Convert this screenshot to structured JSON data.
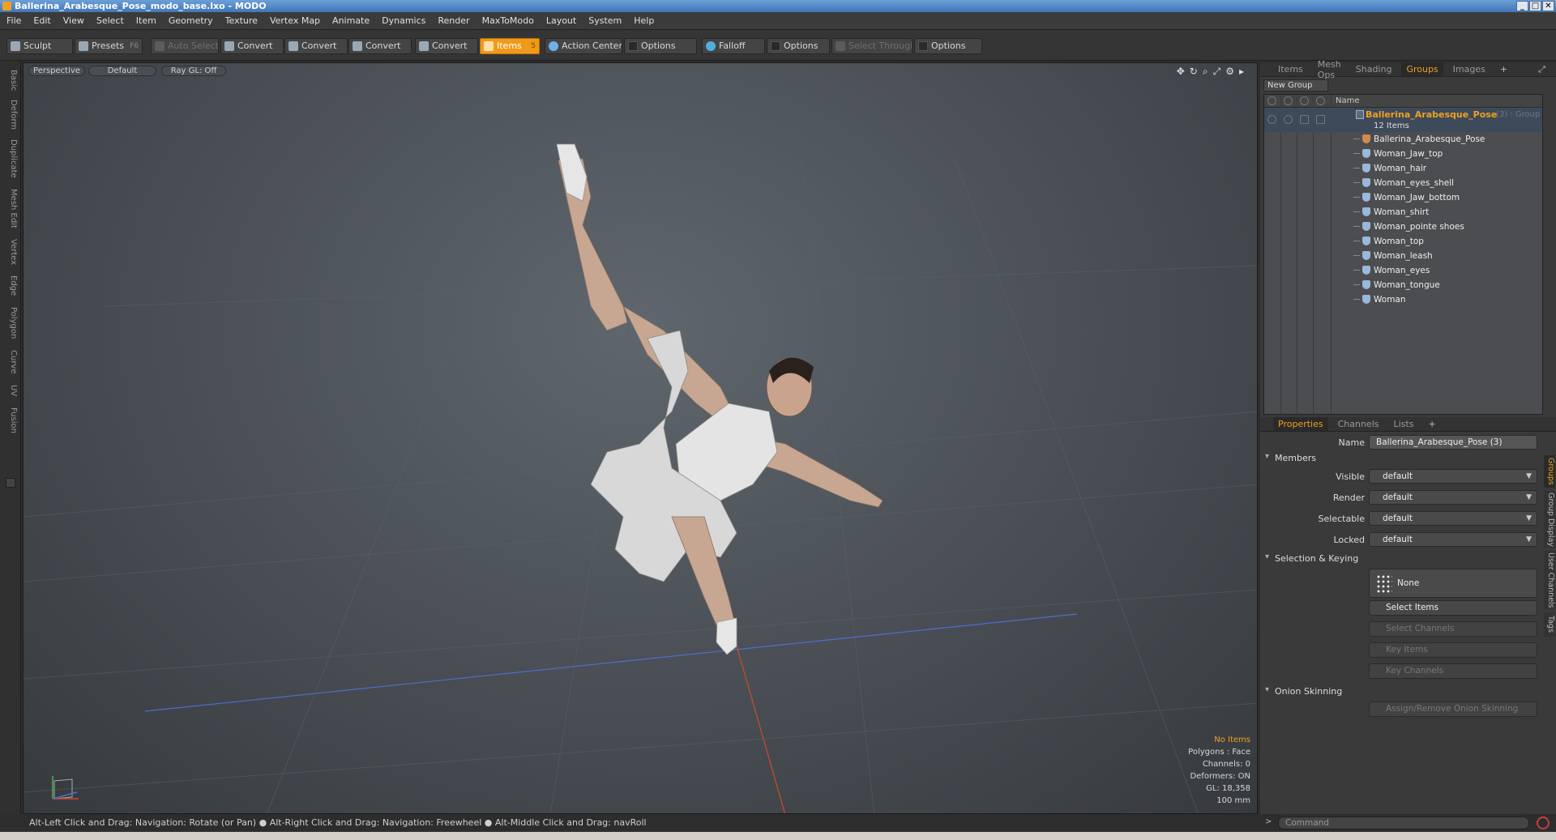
{
  "window": {
    "title": "Ballerina_Arabesque_Pose_modo_base.lxo - MODO"
  },
  "menu": [
    "File",
    "Edit",
    "View",
    "Select",
    "Item",
    "Geometry",
    "Texture",
    "Vertex Map",
    "Animate",
    "Dynamics",
    "Render",
    "MaxToModo",
    "Layout",
    "System",
    "Help"
  ],
  "toolbar": {
    "sculpt": "Sculpt",
    "presets": "Presets",
    "presets_key": "F6",
    "auto_select": "Auto Select",
    "convert1": "Convert",
    "convert2": "Convert",
    "convert3": "Convert",
    "convert4": "Convert",
    "items": "Items",
    "items_key": "5",
    "action_center": "Action Center",
    "options1": "Options",
    "falloff": "Falloff",
    "options2": "Options",
    "select_through": "Select Through",
    "options3": "Options"
  },
  "left_tabs": [
    "Basic",
    "Deform",
    "Duplicate",
    "Mesh Edit",
    "Vertex",
    "Edge",
    "Polygon",
    "Curve",
    "UV",
    "Fusion"
  ],
  "viewport": {
    "view": "Perspective",
    "shading": "Default",
    "raygl": "Ray GL: Off",
    "info": {
      "selection": "No Items",
      "polygons": "Polygons : Face",
      "channels": "Channels: 0",
      "deformers": "Deformers: ON",
      "gl": "GL: 18,358",
      "scale": "100 mm"
    }
  },
  "status": "Alt-Left Click and Drag: Navigation: Rotate (or Pan) ● Alt-Right Click and Drag: Navigation: Freewheel ● Alt-Middle Click and Drag: navRoll",
  "top_tabs": [
    {
      "label": "Items",
      "active": false
    },
    {
      "label": "Mesh Ops",
      "active": false
    },
    {
      "label": "Shading",
      "active": false
    },
    {
      "label": "Groups",
      "active": true
    },
    {
      "label": "Images",
      "active": false
    }
  ],
  "groups": {
    "new_group": "New Group",
    "col_name": "Name",
    "group_name": "Ballerina_Arabesque_Pose",
    "group_extra": "(3) : Group",
    "count": "12 Items",
    "items": [
      "Ballerina_Arabesque_Pose",
      "Woman_Jaw_top",
      "Woman_hair",
      "Woman_eyes_shell",
      "Woman_Jaw_bottom",
      "Woman_shirt",
      "Woman_pointe shoes",
      "Woman_top",
      "Woman_leash",
      "Woman_eyes",
      "Woman_tongue",
      "Woman"
    ]
  },
  "bottom_tabs": [
    {
      "label": "Properties",
      "active": true
    },
    {
      "label": "Channels",
      "active": false
    },
    {
      "label": "Lists",
      "active": false
    }
  ],
  "properties": {
    "name_label": "Name",
    "name_value": "Ballerina_Arabesque_Pose (3)",
    "members": "Members",
    "visible_label": "Visible",
    "visible": "default",
    "render_label": "Render",
    "render": "default",
    "selectable_label": "Selectable",
    "selectable": "default",
    "locked_label": "Locked",
    "locked": "default",
    "selection_keying": "Selection & Keying",
    "none": "None",
    "select_items": "Select Items",
    "select_channels": "Select Channels",
    "key_items": "Key Items",
    "key_channels": "Key Channels",
    "onion": "Onion Skinning",
    "assign_onion": "Assign/Remove Onion Skinning"
  },
  "side_tabs": [
    "Groups",
    "Group Display",
    "User Channels",
    "Tags"
  ],
  "command": {
    "placeholder": "Command"
  },
  "colors": {
    "accent": "#f0a020",
    "viewport": "#4c5258",
    "panel": "#3a3a3a"
  }
}
